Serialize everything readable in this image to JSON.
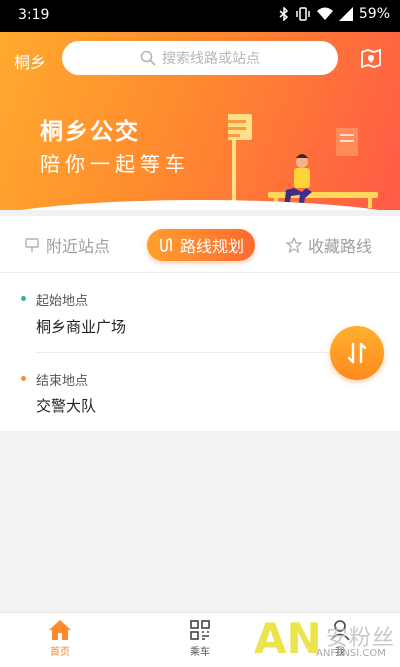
{
  "status_bar": {
    "time": "3:19",
    "battery": "59%"
  },
  "header": {
    "city": "桐乡",
    "search_placeholder": "搜索线路或站点",
    "title": "桐乡公交",
    "subtitle": "陪你一起等车"
  },
  "tabs": [
    {
      "label": "附近站点",
      "active": false
    },
    {
      "label": "路线规划",
      "active": true
    },
    {
      "label": "收藏路线",
      "active": false
    }
  ],
  "route": {
    "start_label": "起始地点",
    "start_value": "桐乡商业广场",
    "end_label": "结束地点",
    "end_value": "交警大队"
  },
  "bottom_nav": [
    {
      "label": "首页",
      "icon": "home-icon",
      "active": true
    },
    {
      "label": "乘车",
      "icon": "qr-grid-icon",
      "active": false
    },
    {
      "label": "我",
      "icon": "user-icon",
      "active": false
    }
  ],
  "watermark": {
    "logo": "AN",
    "text_cn": "安粉丝",
    "text_en": "ANFENSI.COM"
  },
  "colors": {
    "accent": "#ff8a2e",
    "start_dot": "#2bb5a0",
    "end_dot": "#ff8a2e"
  }
}
